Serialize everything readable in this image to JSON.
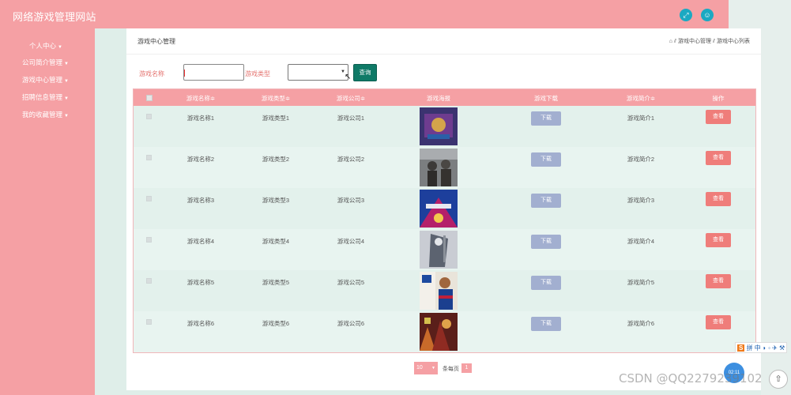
{
  "app": {
    "title": "网络游戏管理网站"
  },
  "sidebar": {
    "items": [
      {
        "label": "个人中心"
      },
      {
        "label": "公司简介管理"
      },
      {
        "label": "游戏中心管理"
      },
      {
        "label": "招聘信息管理"
      },
      {
        "label": "我的收藏管理"
      }
    ]
  },
  "page": {
    "title": "游戏中心管理",
    "breadcrumb": [
      "游戏中心管理",
      "游戏中心列表"
    ]
  },
  "search": {
    "name_label": "游戏名称",
    "name_value": "",
    "type_label": "游戏类型",
    "type_value": "",
    "query_label": "查询"
  },
  "table": {
    "columns": [
      "游戏名称",
      "游戏类型",
      "游戏公司",
      "游戏海报",
      "游戏下载",
      "游戏简介",
      "操作"
    ],
    "sort_columns": [
      "游戏名称",
      "游戏类型",
      "游戏公司",
      "游戏简介"
    ],
    "rows": [
      {
        "name": "游戏名称1",
        "type": "游戏类型1",
        "company": "游戏公司1",
        "intro": "游戏简介1"
      },
      {
        "name": "游戏名称2",
        "type": "游戏类型2",
        "company": "游戏公司2",
        "intro": "游戏简介2"
      },
      {
        "name": "游戏名称3",
        "type": "游戏类型3",
        "company": "游戏公司3",
        "intro": "游戏简介3"
      },
      {
        "name": "游戏名称4",
        "type": "游戏类型4",
        "company": "游戏公司4",
        "intro": "游戏简介4"
      },
      {
        "name": "游戏名称5",
        "type": "游戏类型5",
        "company": "游戏公司5",
        "intro": "游戏简介5"
      },
      {
        "name": "游戏名称6",
        "type": "游戏类型6",
        "company": "游戏公司6",
        "intro": "游戏简介6"
      }
    ],
    "download_label": "下载",
    "view_label": "查看"
  },
  "pager": {
    "page_size": "10",
    "page_size_label": "条每页",
    "current_page": "1"
  },
  "overlay": {
    "ime_text": "拼 中 ◗ ◦ ✈ ⚒",
    "ime_logo": "S",
    "clock": "02:11",
    "watermark": "CSDN @QQ2279239102"
  },
  "colors": {
    "brand_pink": "#f5a0a4",
    "query_button": "#0f7a67",
    "download_button": "#a2afd0",
    "view_button": "#ef7d7a",
    "top_icon": "#1ba9c2"
  }
}
